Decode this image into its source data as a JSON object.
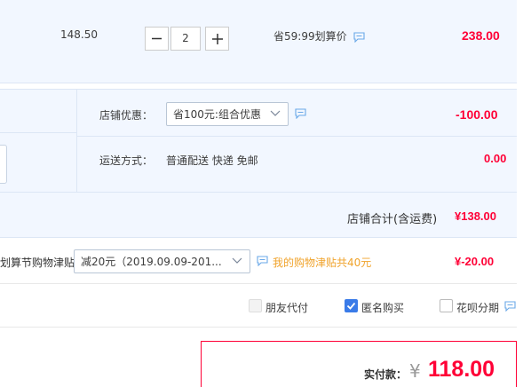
{
  "item": {
    "unit_price": "148.50",
    "quantity": "2",
    "minus_label": "−",
    "plus_label": "+",
    "promo_text": "省59:99划算价",
    "subtotal": "238.00"
  },
  "store": {
    "discount_label": "店铺优惠：",
    "discount_select": "省100元:组合优惠",
    "discount_amount": "-100.00",
    "shipping_label": "运送方式：",
    "shipping_value": "普通配送 快递 免邮",
    "shipping_amount": "0.00",
    "total_label": "店铺合计(含运费)",
    "total_amount": "¥138.00"
  },
  "allowance": {
    "label": "划算节购物津贴",
    "select": "减20元（2019.09.09-201...",
    "note": "我的购物津贴共40元",
    "amount": "¥-20.00"
  },
  "options": {
    "friend_pay": "朋友代付",
    "anonymous": "匿名购买",
    "huabei": "花呗分期"
  },
  "payment": {
    "label": "实付款：",
    "currency": "¥",
    "amount": "118.00"
  },
  "colors": {
    "accent_red": "#ff0036",
    "link_orange": "#f0a32b",
    "panel_blue": "#f2f7ff",
    "checkbox_blue": "#3a7be8"
  }
}
